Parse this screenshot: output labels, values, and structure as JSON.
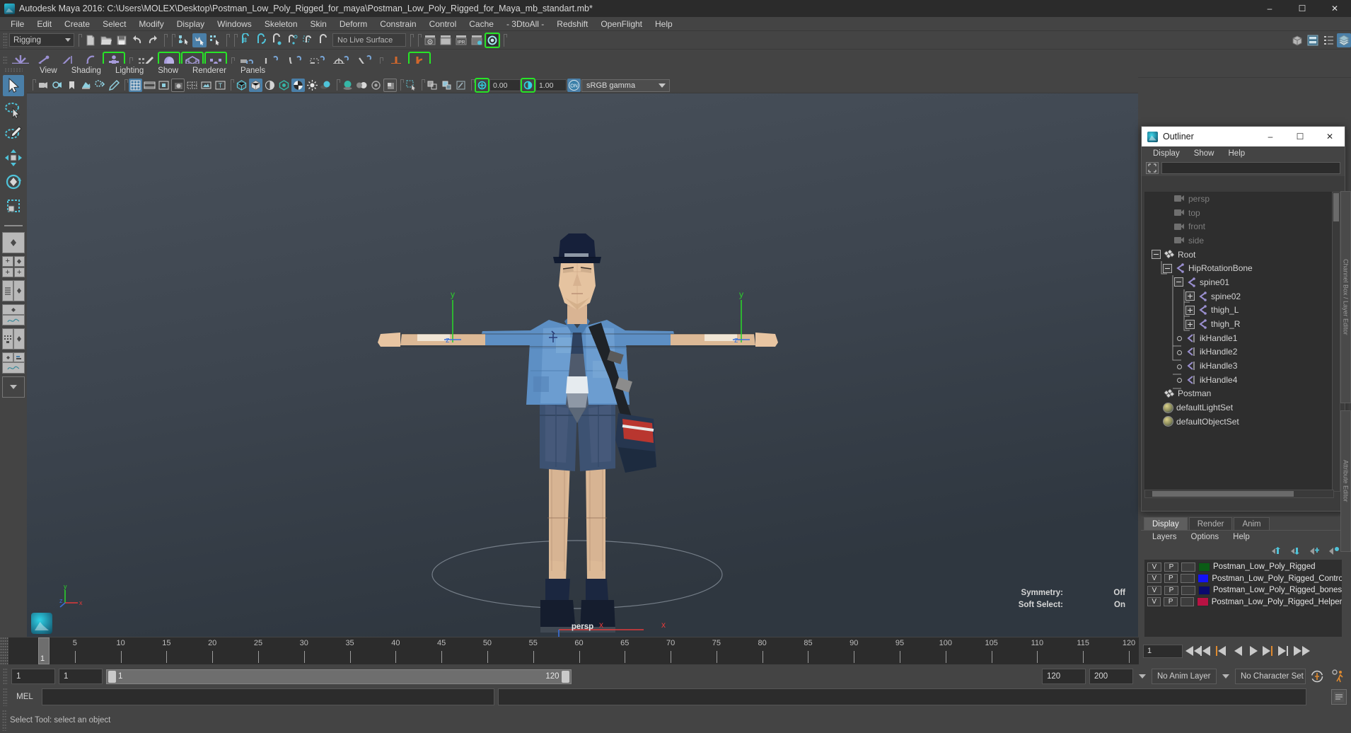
{
  "window": {
    "title": "Autodesk Maya 2016: C:\\Users\\MOLEX\\Desktop\\Postman_Low_Poly_Rigged_for_maya\\Postman_Low_Poly_Rigged_for_Maya_mb_standart.mb*",
    "minimize": "–",
    "maximize": "☐",
    "close": "✕"
  },
  "menubar": {
    "items": [
      "File",
      "Edit",
      "Create",
      "Select",
      "Modify",
      "Display",
      "Windows",
      "Skeleton",
      "Skin",
      "Deform",
      "Constrain",
      "Control",
      "Cache",
      "- 3DtoAll -",
      "Redshift",
      "OpenFlight",
      "Help"
    ]
  },
  "statusline": {
    "menu_set": "Rigging",
    "live_surface": "No Live Surface",
    "icons": [
      "new-scene-icon",
      "open-scene-icon",
      "save-scene-icon",
      "undo-icon",
      "redo-icon",
      "select-by-hierarchy-icon",
      "select-by-object-icon",
      "select-by-component-icon",
      "snap-to-grid-icon",
      "snap-to-curve-icon",
      "snap-to-point-icon",
      "snap-to-projected-center-icon",
      "snap-to-view-plane-icon",
      "make-live-icon",
      "render-current-frame-icon",
      "ipr-render-icon",
      "render-settings-icon",
      "hypershade-icon",
      "show-hide-modeling-toolkit-icon",
      "show-hide-attribute-editor-icon",
      "show-hide-tool-settings-icon",
      "show-hide-channel-box-icon"
    ]
  },
  "shelf": {
    "icons": [
      "create-joint-icon",
      "mirror-joint-icon",
      "orient-joint-icon",
      "ik-handle-icon",
      "ik-spline-handle-icon",
      "bind-skin-icon",
      "interactive-bind-icon",
      "smooth-bind-icon",
      "paint-skin-weights-icon",
      "parent-constraint-icon",
      "point-constraint-icon",
      "orient-constraint-icon",
      "scale-constraint-icon",
      "aim-constraint-icon",
      "pole-vector-constraint-icon",
      "set-preferred-angle-icon",
      "assume-preferred-angle-icon"
    ]
  },
  "toolbox": {
    "tools": [
      {
        "name": "select-tool",
        "active": true
      },
      {
        "name": "lasso-select-tool",
        "active": false
      },
      {
        "name": "paint-select-tool",
        "active": false
      },
      {
        "name": "move-tool",
        "active": false
      },
      {
        "name": "rotate-tool",
        "active": false
      },
      {
        "name": "scale-tool",
        "active": false
      }
    ],
    "layout_presets": [
      "single-perspective-view",
      "four-view-layout",
      "persp-outliner-layout",
      "persp-graph-editor-layout",
      "persp-hypershade-layout",
      "persp-relationship-editor-layout",
      "more-layouts-dropdown"
    ]
  },
  "viewport": {
    "menus": [
      "View",
      "Shading",
      "Lighting",
      "Show",
      "Renderer",
      "Panels"
    ],
    "exposure_value": "0.00",
    "gamma_value": "1.00",
    "color_management": "sRGB gamma",
    "view_toggle": "ON",
    "camera_label": "persp",
    "hud": [
      {
        "label": "Symmetry:",
        "value": "Off"
      },
      {
        "label": "Soft Select:",
        "value": "On"
      }
    ],
    "axis_labels": {
      "x": "x",
      "y": "y",
      "z": "z"
    },
    "manipulator_labels": [
      "y",
      "y",
      "x",
      "x"
    ],
    "toolbar_icons": [
      "select-camera-icon",
      "camera-attributes-icon",
      "bookmark-icon",
      "image-plane-icon",
      "two-d-pan-zoom-icon",
      "grease-pencil-icon",
      "grid-toggle-icon",
      "film-gate-icon",
      "resolution-gate-icon",
      "gate-mask-icon",
      "field-chart-icon",
      "safe-action-icon",
      "safe-title-icon",
      "wireframe-icon",
      "smooth-shade-all-icon",
      "shaded-wireframe-icon",
      "use-default-material-icon",
      "textured-icon",
      "use-all-lights-icon",
      "shadows-icon",
      "screen-space-ao-icon",
      "motion-blur-icon",
      "multisample-aa-icon",
      "depth-of-field-icon",
      "isolate-select-icon",
      "xray-icon",
      "xray-joints-icon",
      "exposure-icon",
      "gamma-icon"
    ]
  },
  "outliner": {
    "title": "Outliner",
    "menus": [
      "Display",
      "Show",
      "Help"
    ],
    "search_placeholder": "",
    "tree": [
      {
        "label": "persp",
        "depth": 1,
        "icon": "camera-icon",
        "state": "none",
        "dim": true
      },
      {
        "label": "top",
        "depth": 1,
        "icon": "camera-icon",
        "state": "none",
        "dim": true
      },
      {
        "label": "front",
        "depth": 1,
        "icon": "camera-icon",
        "state": "none",
        "dim": true
      },
      {
        "label": "side",
        "depth": 1,
        "icon": "camera-icon",
        "state": "none",
        "dim": true
      },
      {
        "label": "Root",
        "depth": 0,
        "icon": "group-icon",
        "state": "minus",
        "dim": false
      },
      {
        "label": "HipRotationBone",
        "depth": 1,
        "icon": "joint-icon",
        "state": "minus",
        "dim": false
      },
      {
        "label": "spine01",
        "depth": 2,
        "icon": "joint-icon",
        "state": "minus",
        "dim": false
      },
      {
        "label": "spine02",
        "depth": 3,
        "icon": "joint-icon",
        "state": "plus",
        "dim": false
      },
      {
        "label": "thigh_L",
        "depth": 3,
        "icon": "joint-icon",
        "state": "plus",
        "dim": false
      },
      {
        "label": "thigh_R",
        "depth": 3,
        "icon": "joint-icon",
        "state": "plus",
        "dim": false
      },
      {
        "label": "ikHandle1",
        "depth": 2,
        "icon": "ik-handle-icon",
        "state": "leaf",
        "dim": false
      },
      {
        "label": "ikHandle2",
        "depth": 2,
        "icon": "ik-handle-icon",
        "state": "leaf",
        "dim": false
      },
      {
        "label": "ikHandle3",
        "depth": 2,
        "icon": "ik-handle-icon",
        "state": "leaf",
        "dim": false
      },
      {
        "label": "ikHandle4",
        "depth": 2,
        "icon": "ik-handle-icon",
        "state": "leaf",
        "dim": false
      },
      {
        "label": "Postman",
        "depth": 0,
        "icon": "group-icon",
        "state": "none",
        "dim": false
      },
      {
        "label": "defaultLightSet",
        "depth": 0,
        "icon": "set-icon",
        "state": "none",
        "dim": false
      },
      {
        "label": "defaultObjectSet",
        "depth": 0,
        "icon": "set-icon",
        "state": "none",
        "dim": false
      }
    ]
  },
  "layer_editor": {
    "tabs": [
      {
        "label": "Display",
        "active": true
      },
      {
        "label": "Render",
        "active": false
      },
      {
        "label": "Anim",
        "active": false
      }
    ],
    "menus": [
      "Layers",
      "Options",
      "Help"
    ],
    "buttons": [
      "move-layer-up-icon",
      "move-layer-down-icon",
      "new-layer-from-selected-icon",
      "new-layer-icon"
    ],
    "columns": [
      "V",
      "P",
      ""
    ],
    "layers": [
      {
        "visible": "V",
        "playback": "P",
        "type": "",
        "color": "#0b5c16",
        "name": "Postman_Low_Poly_Rigged"
      },
      {
        "visible": "V",
        "playback": "P",
        "type": "",
        "color": "#1313f5",
        "name": "Postman_Low_Poly_Rigged_Control"
      },
      {
        "visible": "V",
        "playback": "P",
        "type": "",
        "color": "#0a0a6e",
        "name": "Postman_Low_Poly_Rigged_bones"
      },
      {
        "visible": "V",
        "playback": "P",
        "type": "",
        "color": "#b81243",
        "name": "Postman_Low_Poly_Rigged_Helpers"
      }
    ]
  },
  "side_tabs": [
    "Channel Box / Layer Editor",
    "Attribute Editor"
  ],
  "timeline": {
    "current_frame": "1",
    "playhead_label": "1",
    "ticks": [
      5,
      10,
      15,
      20,
      25,
      30,
      35,
      40,
      45,
      50,
      55,
      60,
      65,
      70,
      75,
      80,
      85,
      90,
      95,
      100,
      105,
      110,
      115,
      120
    ],
    "start": 1,
    "end": 120,
    "playback_buttons": [
      "go-to-start-icon",
      "step-back-keyframe-icon",
      "step-back-frame-icon",
      "play-backwards-icon",
      "play-forwards-icon",
      "step-forward-frame-icon",
      "step-forward-keyframe-icon",
      "go-to-end-icon"
    ]
  },
  "range_slider": {
    "anim_start": "1",
    "anim_end": "1",
    "range_start": "1",
    "range_end": "120",
    "playback_end": "120",
    "anim_total_end": "200",
    "anim_layer": "No Anim Layer",
    "character_set": "No Character Set",
    "auto_key": "auto-keyframe-icon",
    "anim_prefs": "animation-preferences-icon"
  },
  "command_line": {
    "language": "MEL",
    "input_value": "",
    "output_value": "",
    "script_editor": "script-editor-icon"
  },
  "help_line": {
    "text": "Select Tool: select an object"
  },
  "colors": {
    "accent_blue": "#4a7fa8",
    "highlight_green": "#27e527",
    "joint_purple": "#9a8fd0",
    "viewport_bg_top": "#464e58",
    "viewport_bg_bottom": "#323a43"
  }
}
